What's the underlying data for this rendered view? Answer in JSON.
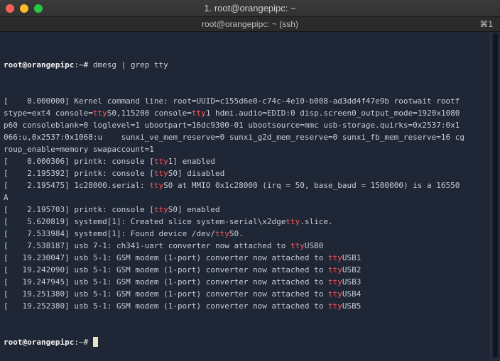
{
  "window": {
    "title": "1. root@orangepipc: ~"
  },
  "tab": {
    "title": "root@orangepipc: ~ (ssh)",
    "shortcut": "⌘1"
  },
  "terminal": {
    "prompt_user": "root@orangepipc",
    "prompt_path": ":~#",
    "command": " dmesg | grep tty",
    "lines": [
      [
        "[    0.000000] Kernel command line: root=UUID=c155d6e0-c74c-4e10-b008-ad3dd4f47e9b rootwait rootf"
      ],
      [
        "stype=ext4 console=",
        "tty",
        "S0,115200 console=",
        "tty",
        "1 hdmi.audio=EDID:0 disp.screen0_output_mode=1920x1080"
      ],
      [
        "p60 consoleblank=0 loglevel=1 ubootpart=16dc9300-01 ubootsource=mmc usb-storage.quirks=0x2537:0x1"
      ],
      [
        "066:u,0x2537:0x1068:u    sunxi_ve_mem_reserve=0 sunxi_g2d_mem_reserve=0 sunxi_fb_mem_reserve=16 cg"
      ],
      [
        "roup_enable=memory swapaccount=1"
      ],
      [
        "[    0.000306] printk: console [",
        "tty",
        "1] enabled"
      ],
      [
        "[    2.195392] printk: console [",
        "tty",
        "S0] disabled"
      ],
      [
        "[    2.195475] 1c28000.serial: ",
        "tty",
        "S0 at MMIO 0x1c28000 (irq = 50, base_baud = 1500000) is a 16550"
      ],
      [
        "A"
      ],
      [
        "[    2.195703] printk: console [",
        "tty",
        "S0] enabled"
      ],
      [
        "[    5.620819] systemd[1]: Created slice system-serial\\x2dge",
        "tty",
        ".slice."
      ],
      [
        "[    7.533984] systemd[1]: Found device /dev/",
        "tty",
        "S0."
      ],
      [
        "[    7.538187] usb 7-1: ch341-uart converter now attached to ",
        "tty",
        "USB0"
      ],
      [
        "[   19.230047] usb 5-1: GSM modem (1-port) converter now attached to ",
        "tty",
        "USB1"
      ],
      [
        "[   19.242090] usb 5-1: GSM modem (1-port) converter now attached to ",
        "tty",
        "USB2"
      ],
      [
        "[   19.247945] usb 5-1: GSM modem (1-port) converter now attached to ",
        "tty",
        "USB3"
      ],
      [
        "[   19.251380] usb 5-1: GSM modem (1-port) converter now attached to ",
        "tty",
        "USB4"
      ],
      [
        "[   19.252380] usb 5-1: GSM modem (1-port) converter now attached to ",
        "tty",
        "USB5"
      ]
    ]
  },
  "colors": {
    "highlight": "#ff5a5a",
    "background": "#1f2635",
    "text": "#c7ccd6"
  }
}
